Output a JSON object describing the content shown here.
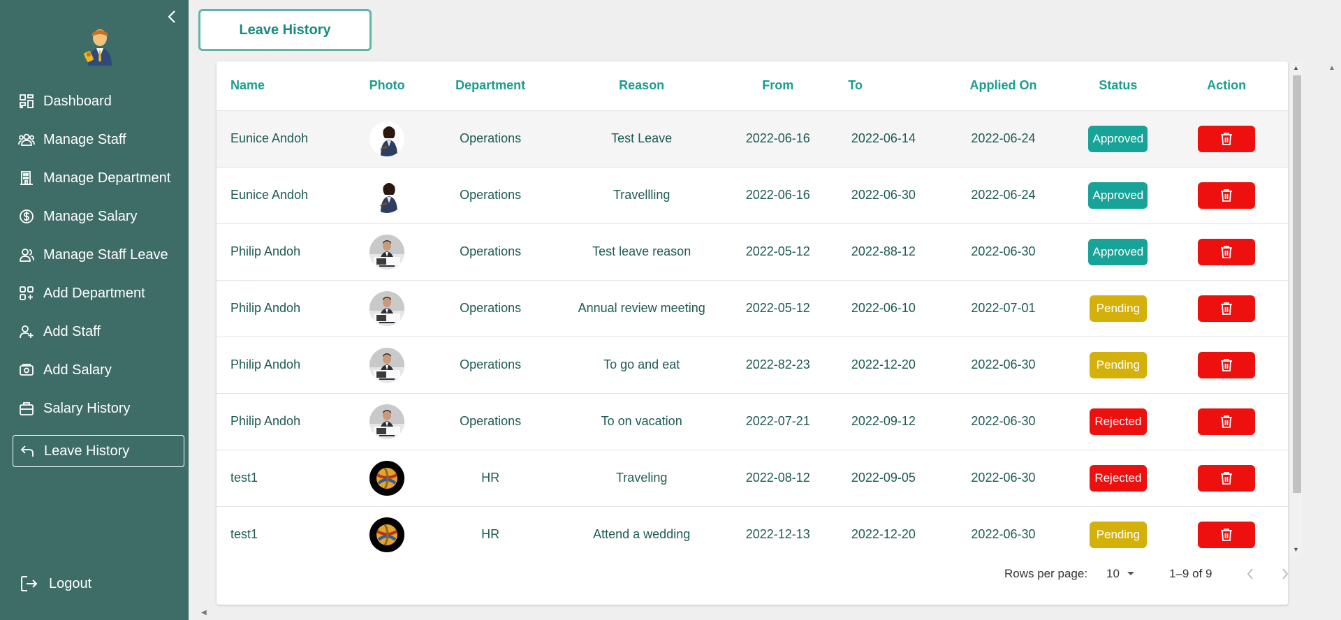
{
  "sidebar": {
    "items": [
      {
        "label": "Dashboard",
        "icon": "dashboard-icon"
      },
      {
        "label": "Manage Staff",
        "icon": "users-icon"
      },
      {
        "label": "Manage Department",
        "icon": "building-icon"
      },
      {
        "label": "Manage Salary",
        "icon": "dollar-circle-icon"
      },
      {
        "label": "Manage Staff Leave",
        "icon": "user-group-icon"
      },
      {
        "label": "Add Department",
        "icon": "grid-plus-icon"
      },
      {
        "label": "Add Staff",
        "icon": "user-plus-icon"
      },
      {
        "label": "Add Salary",
        "icon": "money-icon"
      },
      {
        "label": "Salary History",
        "icon": "briefcase-icon"
      },
      {
        "label": "Leave History",
        "icon": "return-arrow-icon"
      }
    ],
    "active_index": 9,
    "logout_label": "Logout"
  },
  "header": {
    "title": "Leave History"
  },
  "table": {
    "columns": [
      "Name",
      "Photo",
      "Department",
      "Reason",
      "From",
      "To",
      "Applied On",
      "Status",
      "Action"
    ],
    "rows": [
      {
        "name": "Eunice Andoh",
        "photo": "woman",
        "department": "Operations",
        "reason": "Test Leave",
        "from": "2022-06-16",
        "to": "2022-06-14",
        "applied_on": "2022-06-24",
        "status": "Approved"
      },
      {
        "name": "Eunice Andoh",
        "photo": "woman",
        "department": "Operations",
        "reason": "Travellling",
        "from": "2022-06-16",
        "to": "2022-06-30",
        "applied_on": "2022-06-24",
        "status": "Approved"
      },
      {
        "name": "Philip Andoh",
        "photo": "man",
        "department": "Operations",
        "reason": "Test leave reason",
        "from": "2022-05-12",
        "to": "2022-88-12",
        "applied_on": "2022-06-30",
        "status": "Approved"
      },
      {
        "name": "Philip Andoh",
        "photo": "man",
        "department": "Operations",
        "reason": "Annual review meeting",
        "from": "2022-05-12",
        "to": "2022-06-10",
        "applied_on": "2022-07-01",
        "status": "Pending"
      },
      {
        "name": "Philip Andoh",
        "photo": "man",
        "department": "Operations",
        "reason": "To go and eat",
        "from": "2022-82-23",
        "to": "2022-12-20",
        "applied_on": "2022-06-30",
        "status": "Pending"
      },
      {
        "name": "Philip Andoh",
        "photo": "man",
        "department": "Operations",
        "reason": "To on vacation",
        "from": "2022-07-21",
        "to": "2022-09-12",
        "applied_on": "2022-06-30",
        "status": "Rejected"
      },
      {
        "name": "test1",
        "photo": "ball",
        "department": "HR",
        "reason": "Traveling",
        "from": "2022-08-12",
        "to": "2022-09-05",
        "applied_on": "2022-06-30",
        "status": "Rejected"
      },
      {
        "name": "test1",
        "photo": "ball",
        "department": "HR",
        "reason": "Attend a wedding",
        "from": "2022-12-13",
        "to": "2022-12-20",
        "applied_on": "2022-06-30",
        "status": "Pending"
      }
    ]
  },
  "status_colors": {
    "Approved": "#17a398",
    "Pending": "#d4b10a",
    "Rejected": "#ee0f0f"
  },
  "pagination": {
    "rows_per_page_label": "Rows per page:",
    "rows_per_page": "10",
    "range": "1–9 of 9"
  },
  "colors": {
    "sidebar": "#3e6d67",
    "accent": "#1a9e8f",
    "delete": "#ee0f0f"
  }
}
